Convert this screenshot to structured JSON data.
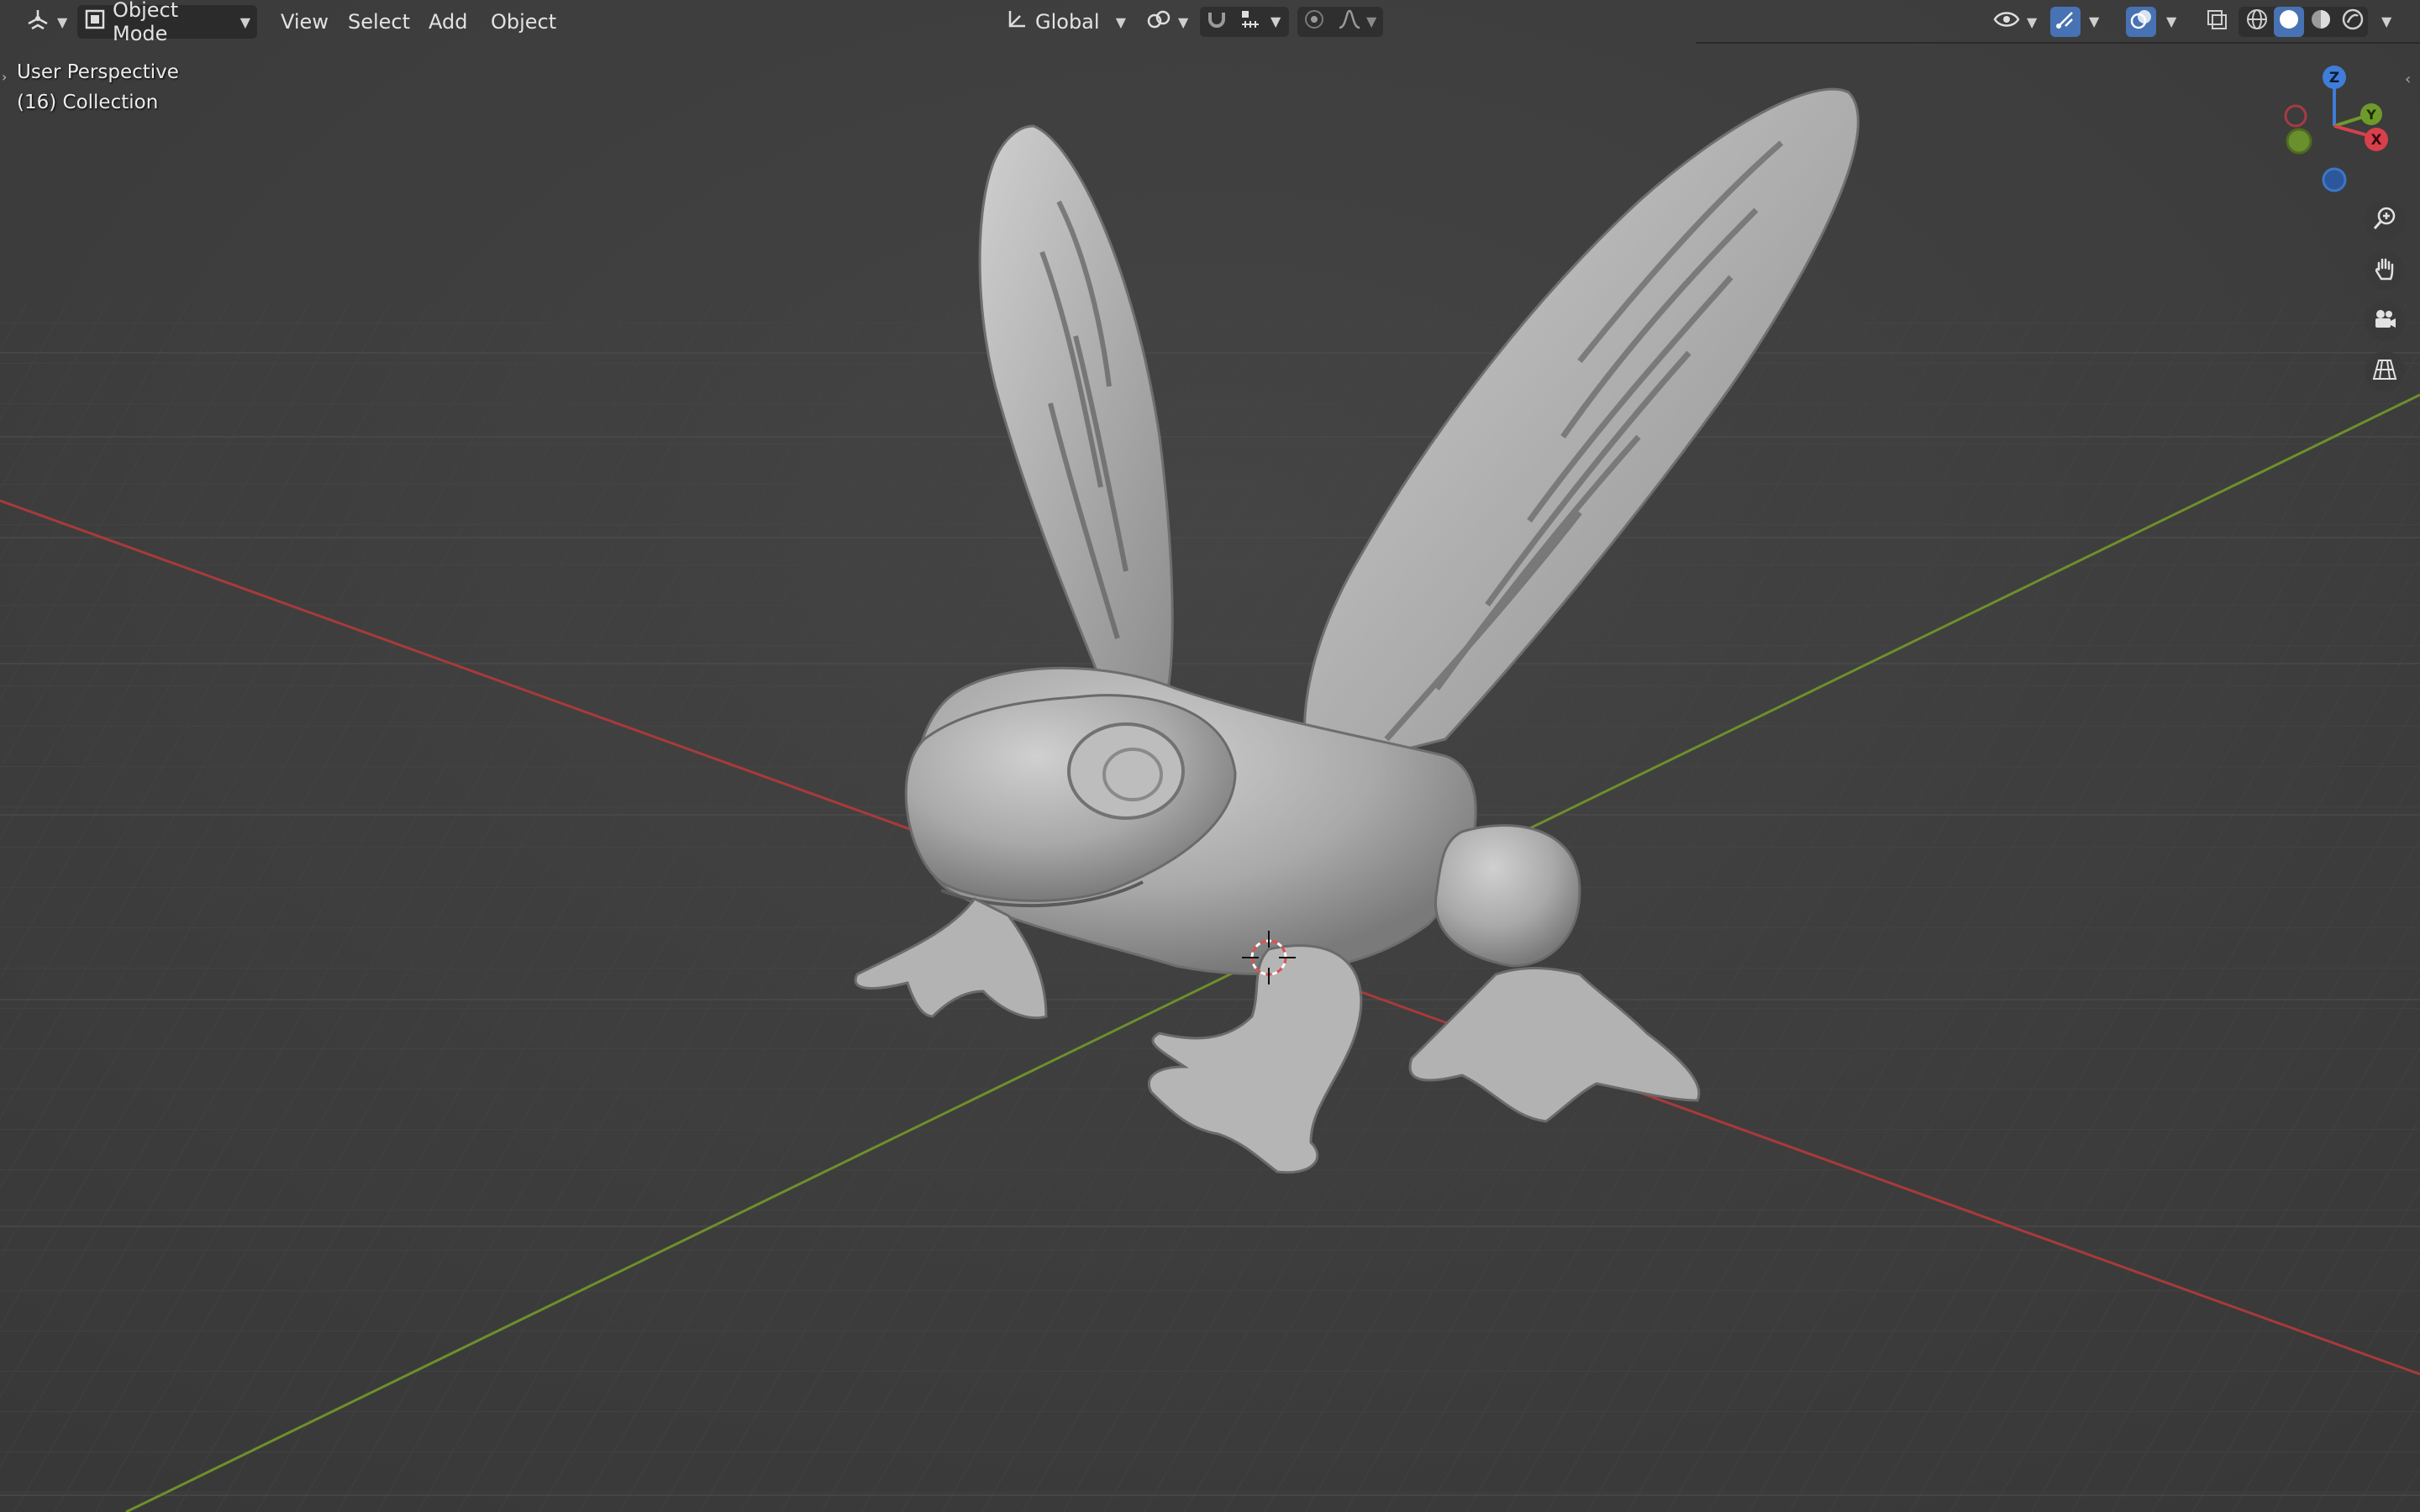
{
  "header": {
    "editor_type_icon": "3d-viewport-icon",
    "mode_label": "Object Mode",
    "menus": [
      "View",
      "Select",
      "Add",
      "Object"
    ],
    "transform_orientation": "Global",
    "icons": {
      "pivot": "pivot-icon",
      "snap": "magnet-icon",
      "snap_target": "snap-increment-icon",
      "proportional": "proportional-edit-icon",
      "falloff": "falloff-curve-icon",
      "visibility": "eye-icon",
      "gizmo": "gizmo-icon",
      "overlay": "overlay-icon",
      "xray": "xray-icon",
      "shading_modes": [
        "wireframe-icon",
        "solid-icon",
        "material-preview-icon",
        "rendered-icon"
      ]
    }
  },
  "viewport": {
    "view_name": "User Perspective",
    "collection": "(16) Collection",
    "axis_gizmo": {
      "x": "X",
      "y": "Y",
      "z": "Z"
    },
    "nav_buttons": [
      "zoom-icon",
      "hand-pan-icon",
      "camera-icon",
      "ortho-grid-icon"
    ]
  },
  "colors": {
    "background": "#3d3d3d",
    "grid": "#4a4a4a",
    "x_axis": "#a83a3a",
    "y_axis": "#6e8f2c",
    "z_axis": "#3f7dd8",
    "model": "#b4b4b4",
    "active": "#4772b3"
  }
}
